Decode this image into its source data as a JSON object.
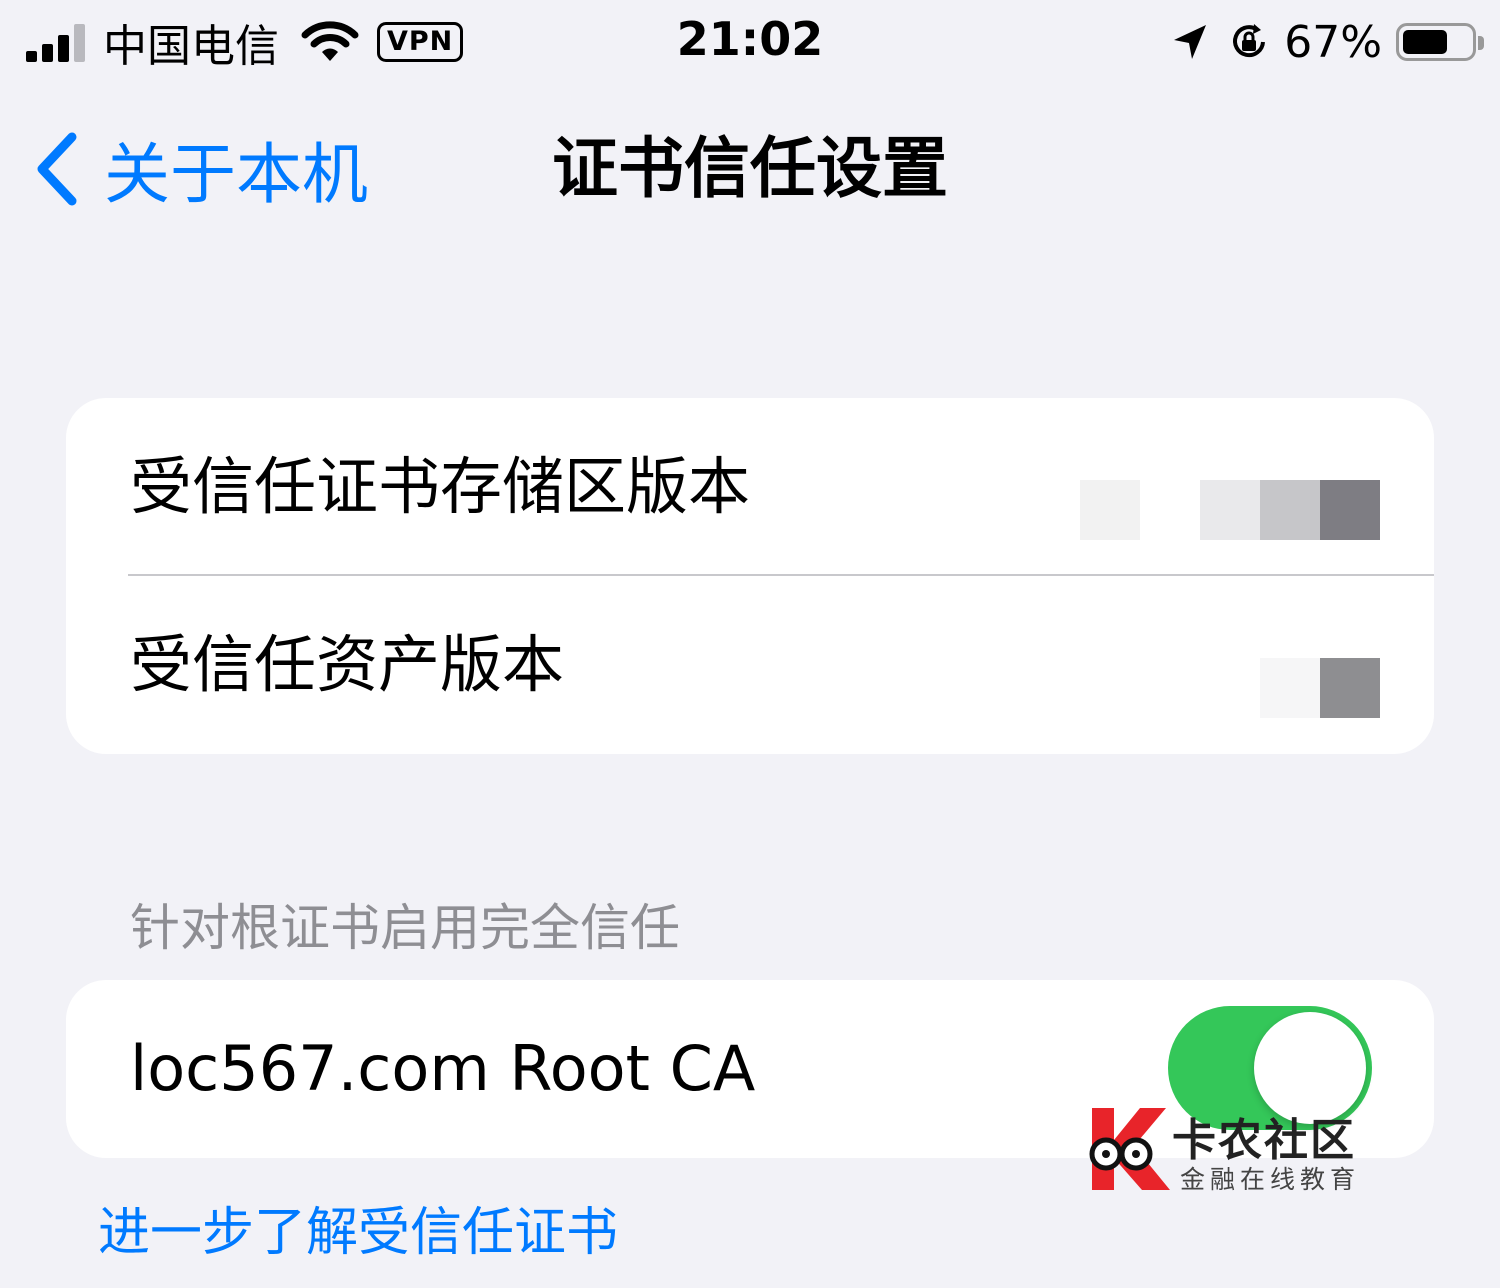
{
  "status_bar": {
    "carrier": "中国电信",
    "vpn": "VPN",
    "time": "21:02",
    "battery_percent": "67%",
    "battery_level": 0.67
  },
  "nav": {
    "back_label": "关于本机",
    "title": "证书信任设置"
  },
  "versions": {
    "store_label": "受信任证书存储区版本",
    "assets_label": "受信任资产版本"
  },
  "trust": {
    "header": "针对根证书启用完全信任",
    "certificate_name": "loc567.com Root CA",
    "enabled": true
  },
  "learn_more": "进一步了解受信任证书",
  "watermark": {
    "name": "卡农社区",
    "subtitle": "金融在线教育"
  },
  "colors": {
    "accent": "#007aff",
    "toggle_on": "#34c759",
    "background": "#f2f2f7",
    "watermark_red": "#e8242a"
  }
}
